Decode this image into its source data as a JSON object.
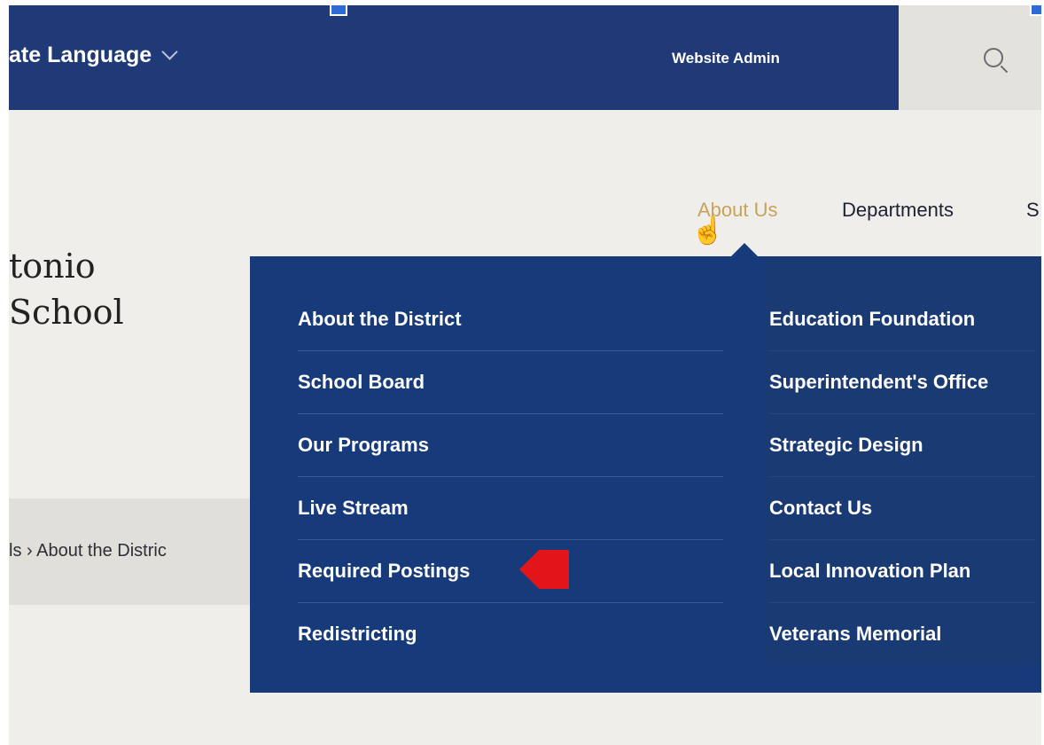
{
  "topbar": {
    "language_label": "ate Language",
    "admin_label": "Website Admin"
  },
  "nav": {
    "about": "About Us",
    "departments": "Departments",
    "partial": "S"
  },
  "logo": {
    "line1": "tonio",
    "line2": "School"
  },
  "breadcrumb": "ls  ›  About the Distric",
  "menu": {
    "left": [
      "About the District",
      "School Board",
      "Our Programs",
      "Live Stream",
      "Required Postings",
      "Redistricting"
    ],
    "right": [
      "Education Foundation",
      "Superintendent's Office",
      "Strategic Design",
      "Contact Us",
      "Local Innovation Plan",
      "Veterans Memorial"
    ]
  },
  "icons": {
    "search": "search-icon",
    "chevron": "chevron-down-icon",
    "cursor": "hand-cursor-icon",
    "highlight": "red-arrow-marker"
  },
  "colors": {
    "header_bg": "#1f3a76",
    "dropdown_bg": "#173b7a",
    "active_nav": "#c9a25a",
    "marker": "#e2161a"
  }
}
